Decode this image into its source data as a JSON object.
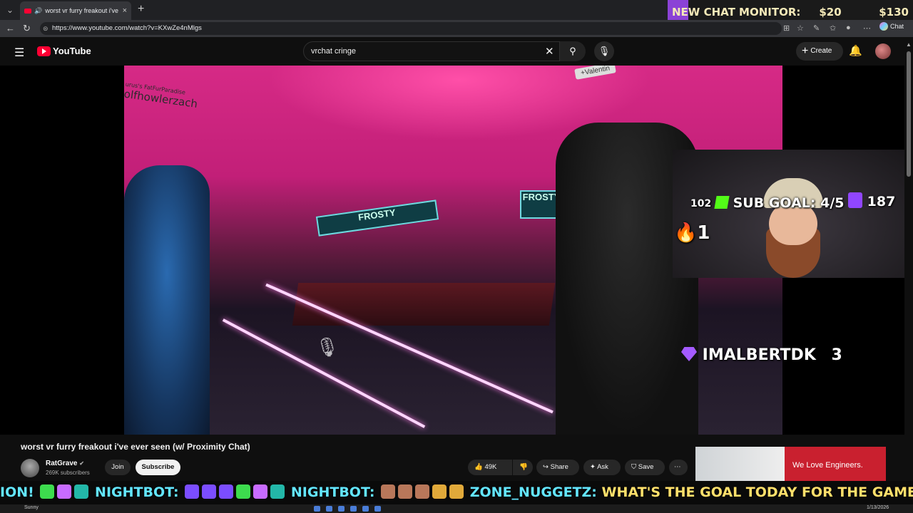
{
  "browser": {
    "tab_title": "worst vr furry freakout i've ever seen (w/ Proximity Chat)",
    "tab_close": "×",
    "new_tab": "+",
    "url": "https://www.youtube.com/watch?v=KXwZe4nMlgs",
    "chat_label": "Chat"
  },
  "stream_monitor": {
    "label": "NEW CHAT MONITOR:",
    "value1": "$20",
    "value2": "$130"
  },
  "youtube": {
    "logo_text": "YouTube",
    "search_value": "vrchat cringe",
    "create_label": "Create"
  },
  "video_overlay": {
    "nametag_small": "urus's FatFurParadise",
    "nametag_main": "olfhowlerzach",
    "nametag_right": "+Valentin",
    "kick_count": "102",
    "sub_goal": "SUB GOAL: 4/5",
    "twitch_count": "187",
    "fire_count": "1",
    "sub_name": "IMALBERTDK",
    "sub_count": "3",
    "ptt_label": "PTT"
  },
  "video": {
    "title": "worst vr furry freakout i've ever seen (w/ Proximity Chat)",
    "channel_name": "RatGrave",
    "subscribers": "269K subscribers",
    "join_label": "Join",
    "subscribe_label": "Subscribe",
    "likes": "49K",
    "share_label": "Share",
    "ask_label": "Ask",
    "save_label": "Save"
  },
  "ad": {
    "text": "We Love Engineers."
  },
  "ticker": {
    "prefix": "ION!",
    "nick1": "NIGHTBOT:",
    "nick2": "NIGHTBOT:",
    "nick3": "ZONE_NUGGETZ:",
    "message": "WHAT'S THE GOAL TODAY FOR THE GAME"
  },
  "taskbar": {
    "weather": "Sunny",
    "date": "1/13/2026"
  },
  "colors": {
    "youtube_red": "#ff0033",
    "monitor_purple": "#8b42d6",
    "ad_red": "#c9202f",
    "ticker_cyan": "#63e6ff"
  }
}
